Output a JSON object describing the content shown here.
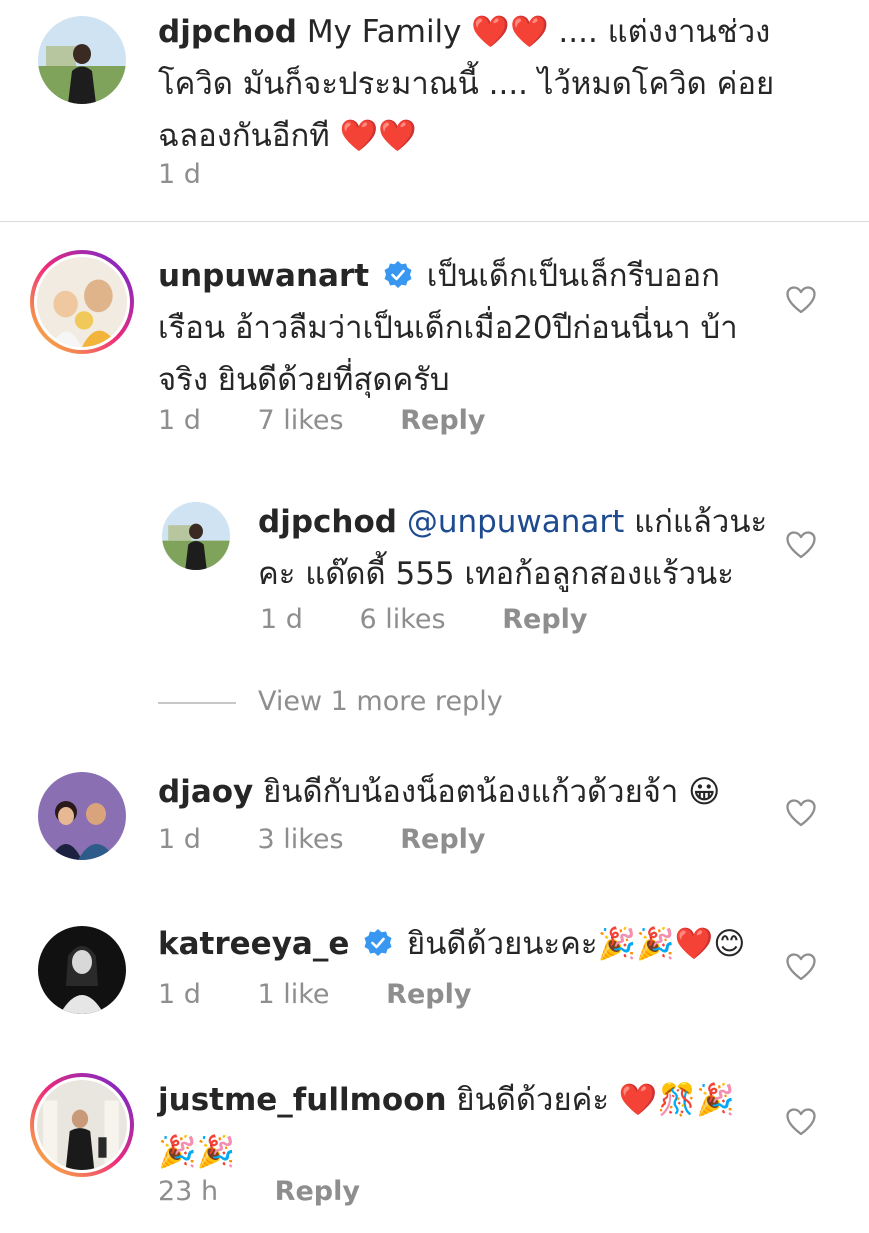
{
  "comments": [
    {
      "username": "djpchod",
      "text_line1": "My Family ❤️❤️ .... แต่งงานช่วง",
      "text_line2": "โควิด มันก็จะประมาณนี้ .... ไว้หมดโควิด ค่อย",
      "text_line3": "ฉลองกันอีกที ❤️❤️",
      "time": "1 d"
    },
    {
      "username": "unpuwanart",
      "verified": true,
      "text_line1": "เป็นเด็กเป็นเล็กรีบออก",
      "text_line2": "เรือน อ้าวลืมว่าเป็นเด็กเมื่อ20ปีก่อนนี่นา บ้า",
      "text_line3": "จริง  ยินดีด้วยที่สุดครับ",
      "time": "1 d",
      "likes": "7 likes",
      "reply": "Reply"
    },
    {
      "username": "djpchod",
      "mention": "@unpuwanart",
      "text_line1": " แก่แล้วนะ",
      "text_line2": "คะ แด๊ดดี้ 555 เทอก้อลูกสองแร้วนะ",
      "time": "1 d",
      "likes": "6 likes",
      "reply": "Reply"
    },
    {
      "username": "djaoy",
      "text_line1": " ยินดีกับน้องน็อตน้องแก้วด้วยจ้า 😀",
      "time": "1 d",
      "likes": "3 likes",
      "reply": "Reply"
    },
    {
      "username": "katreeya_e",
      "verified": true,
      "text_line1": " ยินดีด้วยนะคะ🎉🎉❤️😊",
      "time": "1 d",
      "likes": "1 like",
      "reply": "Reply"
    },
    {
      "username": "justme_fullmoon",
      "text_line1": " ยินดีด้วยค่ะ ❤️🎊🎉",
      "text_line2": "🎉🎉",
      "time": "23 h",
      "reply": "Reply"
    }
  ],
  "view_more": "View 1 more reply",
  "colors": {
    "text": "#262626",
    "meta": "#8e8e8e",
    "mention": "#1e4b8f",
    "verified": "#3897f0",
    "divider": "#dbdbdb"
  },
  "icons": {
    "like": "heart-outline-icon",
    "verified": "verified-badge-icon"
  }
}
